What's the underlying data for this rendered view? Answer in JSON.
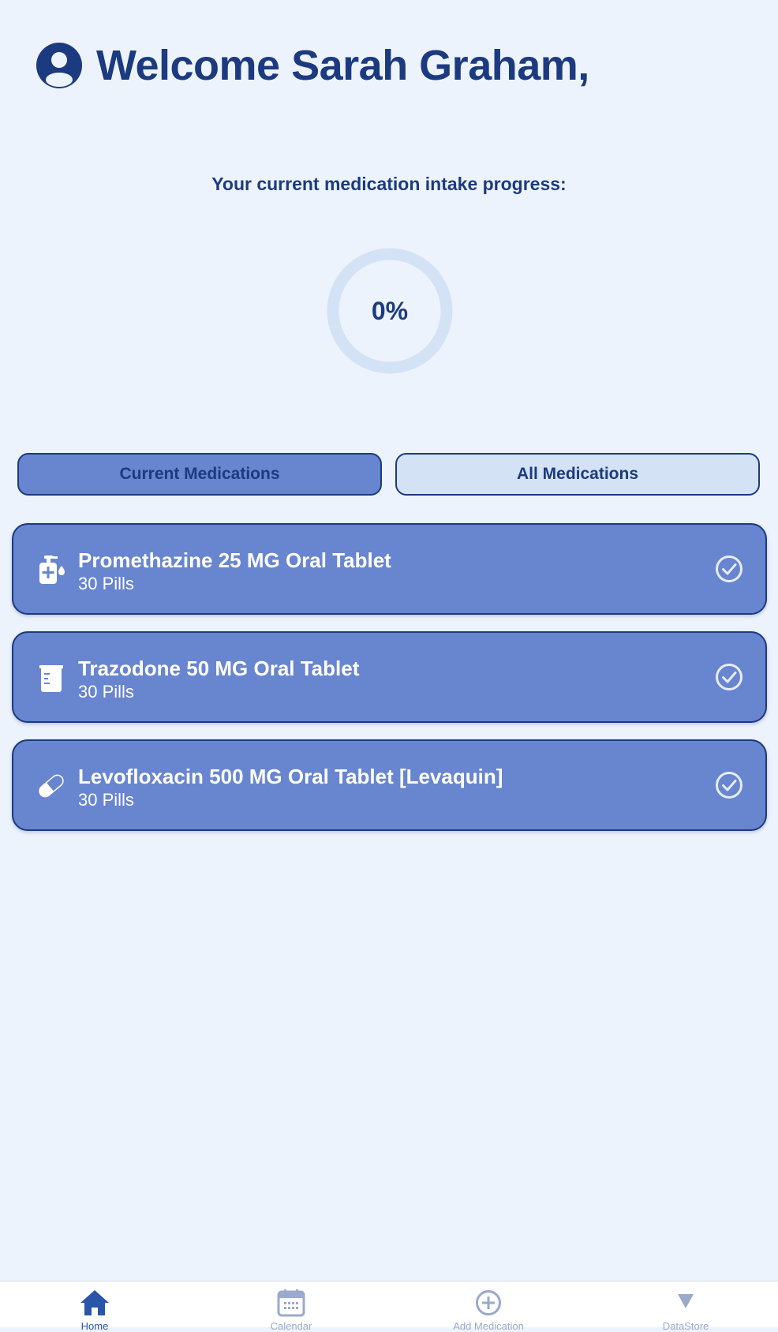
{
  "header": {
    "title": "Welcome Sarah Graham,"
  },
  "progress": {
    "label": "Your current medication intake progress:",
    "value_text": "0%",
    "value": 0
  },
  "tabs": {
    "current_label": "Current Medications",
    "all_label": "All Medications",
    "selected": "current"
  },
  "medications": [
    {
      "name": "Promethazine 25 MG Oral Tablet",
      "count": "30 Pills",
      "icon": "pump-bottle-icon"
    },
    {
      "name": "Trazodone 50 MG Oral Tablet",
      "count": "30 Pills",
      "icon": "beaker-icon"
    },
    {
      "name": "Levofloxacin 500 MG Oral Tablet [Levaquin]",
      "count": "30 Pills",
      "icon": "capsule-icon"
    }
  ],
  "tabbar": {
    "items": [
      {
        "label": "Home",
        "icon": "home-icon",
        "active": true
      },
      {
        "label": "Calendar",
        "icon": "calendar-icon",
        "active": false
      },
      {
        "label": "Add Medication",
        "icon": "plus-circle-icon",
        "active": false
      },
      {
        "label": "DataStore",
        "icon": "triangle-down-icon",
        "active": false
      }
    ]
  },
  "colors": {
    "background": "#edf3fd",
    "primary_text": "#1c3a7f",
    "card": "#6885cf",
    "tab_inactive": "#d4e2f6",
    "ring_track": "#d4e2f6",
    "tabbar_active": "#2a55a8",
    "tabbar_inactive": "#9ba9cc"
  }
}
